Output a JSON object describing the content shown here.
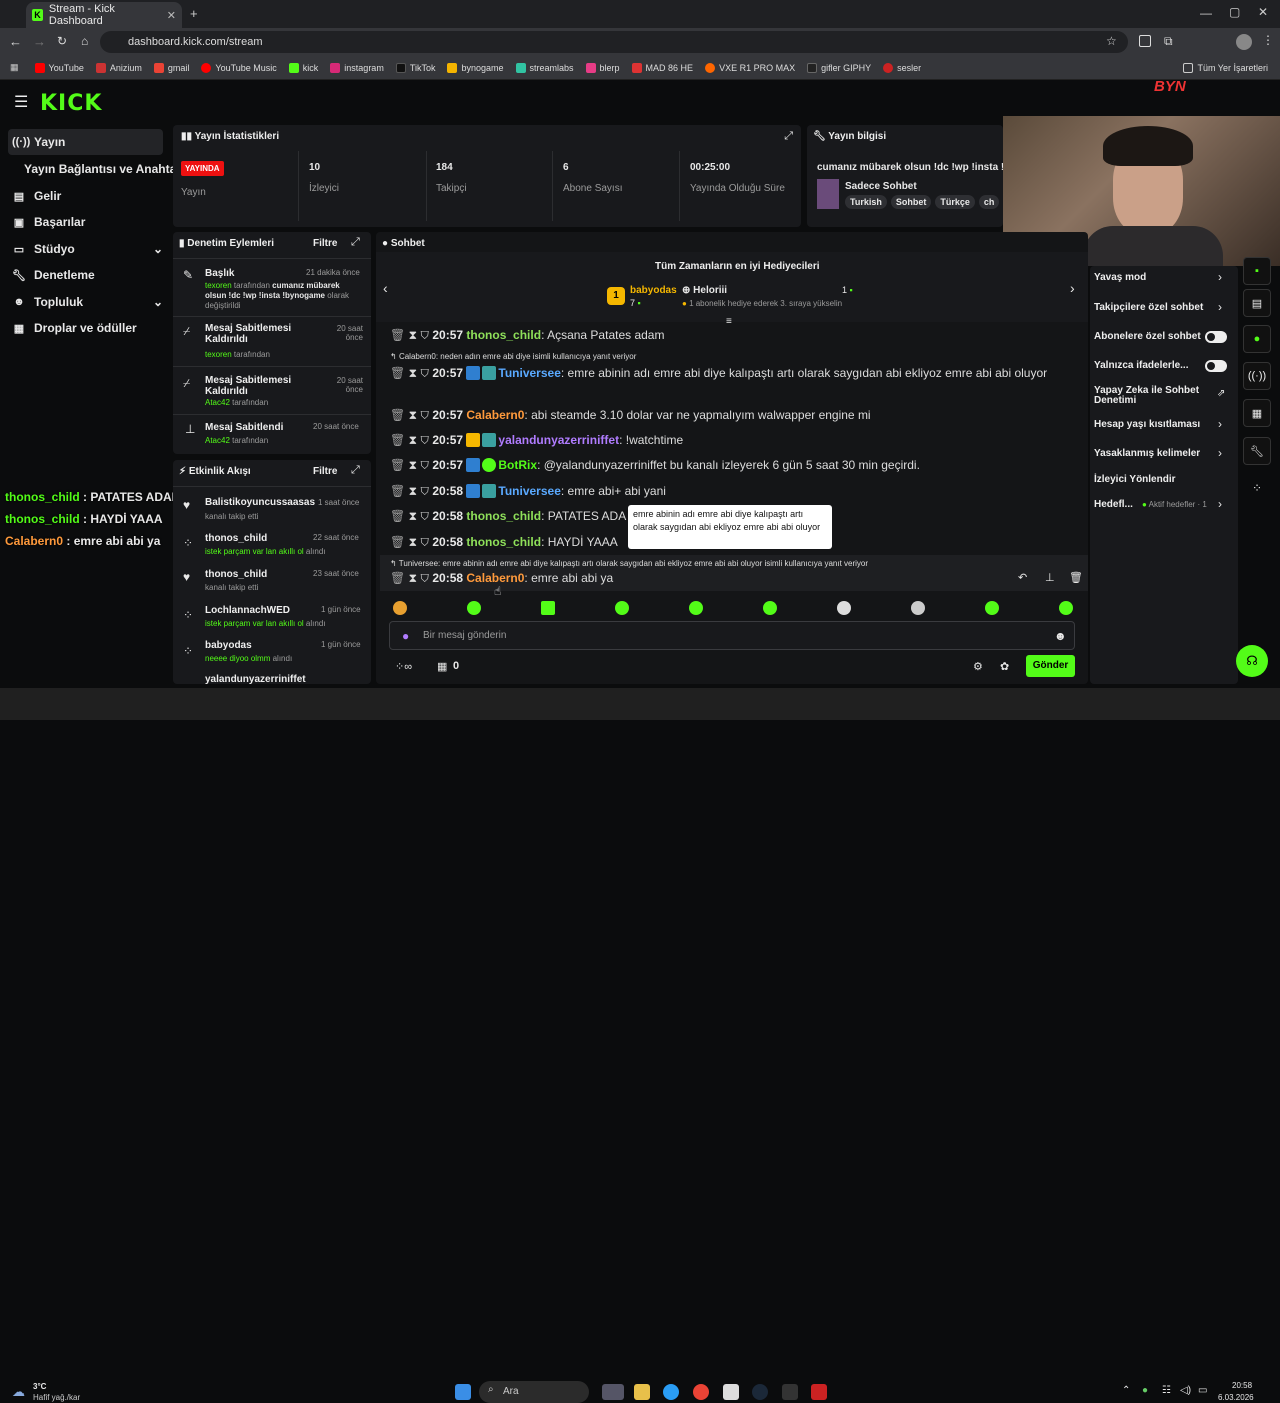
{
  "browser": {
    "tab_title": "Stream - Kick Dashboard",
    "url": "dashboard.kick.com/stream",
    "bookmarks": [
      "YouTube",
      "Anizium",
      "gmail",
      "YouTube Music",
      "kick",
      "instagram",
      "TikTok",
      "bynogame",
      "streamlabs",
      "blerp",
      "MAD 86 HE",
      "VXE R1 PRO MAX",
      "gifler GIPHY",
      "sesler"
    ],
    "all_bookmarks": "Tüm Yer İşaretleri"
  },
  "sidebar": {
    "items": [
      "Yayın",
      "Yayın Bağlantısı ve Anahtarı",
      "Gelir",
      "Başarılar",
      "Stüdyo",
      "Denetleme",
      "Topluluk",
      "Droplar ve ödüller"
    ]
  },
  "stats": {
    "title": "Yayın İstatistikleri",
    "live_badge": "YAYINDA",
    "live_label": "Yayın",
    "items": [
      {
        "value": "10",
        "label": "İzleyici"
      },
      {
        "value": "184",
        "label": "Takipçi"
      },
      {
        "value": "6",
        "label": "Abone Sayısı"
      },
      {
        "value": "00:25:00",
        "label": "Yayında Olduğu Süre"
      }
    ]
  },
  "info": {
    "title": "Yayın bilgisi",
    "stream_title": "cumanız mübarek olsun !dc !wp !insta !by",
    "category": "Sadece Sohbet",
    "tags": [
      "Turkish",
      "Sohbet",
      "Türkçe",
      "ch"
    ]
  },
  "mod": {
    "title": "Denetim Eylemleri",
    "filter": "Filtre",
    "items": [
      {
        "title": "Başlık",
        "time": "21 dakika önce",
        "user": "texoren",
        "pre": " tarafından ",
        "bold": "cumanız mübarek olsun !dc !wp !insta !bynogame",
        "post": " olarak değiştirildi"
      },
      {
        "title": "Mesaj Sabitlemesi Kaldırıldı",
        "time": "20 saat önce",
        "user": "texoren",
        "post": " tarafından"
      },
      {
        "title": "Mesaj Sabitlemesi Kaldırıldı",
        "time": "20 saat önce",
        "user": "Atac42",
        "post": " tarafından"
      },
      {
        "title": "Mesaj Sabitlendi",
        "time": "20 saat önce",
        "user": "Atac42",
        "post": " tarafından"
      }
    ]
  },
  "activity": {
    "title": "Etkinlik Akışı",
    "filter": "Filtre",
    "items": [
      {
        "user": "Balistikoyuncussaasas",
        "time": "1 saat önce",
        "desc": "kanalı takip etti",
        "green": ""
      },
      {
        "user": "thonos_child",
        "time": "22 saat önce",
        "desc": " alındı",
        "green": "istek parçam var lan akıllı ol"
      },
      {
        "user": "thonos_child",
        "time": "23 saat önce",
        "desc": "kanalı takip etti",
        "green": ""
      },
      {
        "user": "LochlannachWED",
        "time": "1 gün önce",
        "desc": " alındı",
        "green": "istek parçam var lan akıllı ol"
      },
      {
        "user": "babyodas",
        "time": "1 gün önce",
        "desc": " alındı",
        "green": "neeee diyoo olmm"
      },
      {
        "user": "yalandunyazerriniffet",
        "time": "",
        "desc": "",
        "green": ""
      }
    ]
  },
  "overlay": [
    {
      "user": "thonos_child",
      "msg": " : PATATES ADAM AÇ"
    },
    {
      "user": "thonos_child",
      "msg": " : HAYDİ YAAA"
    },
    {
      "user": "Calabern0",
      "msg": " : emre abi abi ya"
    }
  ],
  "chat": {
    "title": "Sohbet",
    "gifters_title": "Tüm Zamanların en iyi Hediyecileri",
    "gifter1": {
      "name": "babyodas",
      "count": "7"
    },
    "gifter2": {
      "name": "Heloriii",
      "count": "1",
      "note": "1 abonelik hediye ederek 3. sıraya yükselin"
    },
    "reply1": "Calabern0: neden adın emre abi diye isimli kullanıcıya yanıt veriyor",
    "reply2": "Tuniversee: emre abinin adı emre abi diye kalıpaştı artı olarak saygıdan abi ekliyoz emre abi abi oluyor isimli kullanıcıya yanıt veriyor",
    "messages": [
      {
        "time": "20:57",
        "user": "thonos_child",
        "text": ": Açsana Patates adam",
        "color": "#8fe05a"
      },
      {
        "time": "20:57",
        "user": "Tuniversee",
        "text": ": emre abinin adı emre abi diye kalıpaştı artı olarak saygıdan abi ekliyoz emre abi abi",
        "cont": "oluyor",
        "color": "#5aa9ff"
      },
      {
        "time": "20:57",
        "user": "Calabern0",
        "text": ": abi steamde 3.10 dolar var ne yapmalıyım walwapper engine mi",
        "color": "#ff9a3c"
      },
      {
        "time": "20:57",
        "user": "yalandunyazerriniffet",
        "text": ": !watchtime",
        "color": "#b07cff"
      },
      {
        "time": "20:57",
        "user": "BotRix",
        "text": ": @yalandunyazerriniffet bu kanalı izleyerek 6 gün 5 saat 30 min geçirdi.",
        "color": "#53fc18"
      },
      {
        "time": "20:58",
        "user": "Tuniversee",
        "text": ": emre abi+ abi yani",
        "color": "#5aa9ff"
      },
      {
        "time": "20:58",
        "user": "thonos_child",
        "text": ": PATATES ADA",
        "color": "#8fe05a"
      },
      {
        "time": "20:58",
        "user": "thonos_child",
        "text": ": HAYDİ YAAA",
        "color": "#8fe05a"
      },
      {
        "time": "20:58",
        "user": "Calabern0",
        "text": ": emre abi abi ya",
        "color": "#ff9a3c"
      }
    ],
    "tooltip": "emre abinin adı emre abi diye kalıpaştı artı olarak saygıdan abi ekliyoz emre abi abi oluyor",
    "input_placeholder": "Bir mesaj gönderin",
    "points": "0",
    "send": "Gönder"
  },
  "settings": {
    "items": [
      "Yavaş mod",
      "Takipçilere özel sohbet",
      "Abonelere özel sohbet",
      "Yalnızca ifadelerle...",
      "Yapay Zeka ile Sohbet Denetimi",
      "Hesap yaşı kısıtlaması",
      "Yasaklanmış kelimeler",
      "İzleyici Yönlendir",
      "Hedefl...",
      "Aktif hedefler · 1"
    ]
  },
  "taskbar": {
    "temp": "3°C",
    "weather": "Hafif yağ./kar",
    "search": "Ara",
    "time": "20:58",
    "date": "6.03.2026"
  }
}
